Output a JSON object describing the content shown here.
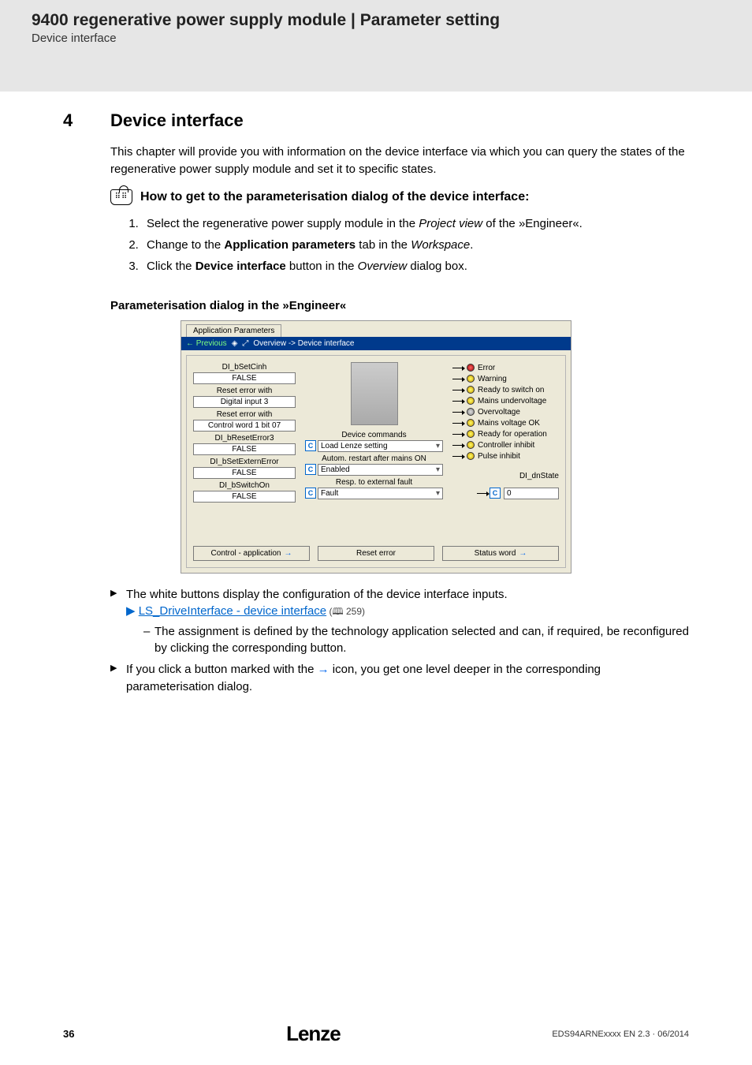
{
  "header": {
    "title": "9400 regenerative power supply module | Parameter setting",
    "subtitle": "Device interface"
  },
  "section": {
    "number": "4",
    "title": "Device interface"
  },
  "intro": "This chapter will provide you with information on the device interface via which you can query the states of the regenerative power supply module and set it to specific states.",
  "howto_title": "How to get to the parameterisation dialog of the device interface:",
  "steps": {
    "s1_a": "Select the regenerative power supply module in the ",
    "s1_b": "Project view",
    "s1_c": " of the »Engineer«.",
    "s2_a": "Change to the ",
    "s2_b": "Application parameters",
    "s2_c": " tab in the ",
    "s2_d": "Workspace",
    "s2_e": ".",
    "s3_a": "Click the ",
    "s3_b": "Device interface",
    "s3_c": " button in the ",
    "s3_d": "Overview",
    "s3_e": " dialog box."
  },
  "sub_heading": "Parameterisation dialog in the »Engineer«",
  "shot": {
    "tab": "Application Parameters",
    "nav_prev": "← Previous",
    "breadcrumb": "Overview -> Device interface",
    "left": [
      {
        "l": "DI_bSetCinh",
        "v": "FALSE"
      },
      {
        "l": "Reset error with",
        "v": "Digital input 3"
      },
      {
        "l": "Reset error with",
        "v": "Control word 1 bit 07"
      },
      {
        "l": "DI_bResetError3",
        "v": "FALSE"
      },
      {
        "l": "DI_bSetExternError",
        "v": "FALSE"
      },
      {
        "l": "DI_bSwitchOn",
        "v": "FALSE"
      }
    ],
    "mid": {
      "l1": "Device commands",
      "dd1": "Load Lenze setting",
      "l2": "Autom. restart after mains ON",
      "dd2": "Enabled",
      "l3": "Resp. to external fault",
      "dd3": "Fault"
    },
    "right": [
      {
        "t": "Error",
        "c": "red"
      },
      {
        "t": "Warning",
        "c": "yellow"
      },
      {
        "t": "Ready to switch on",
        "c": "yellow"
      },
      {
        "t": "Mains undervoltage",
        "c": "yellow"
      },
      {
        "t": "Overvoltage",
        "c": "gray"
      },
      {
        "t": "Mains voltage OK",
        "c": "yellow"
      },
      {
        "t": "Ready for operation",
        "c": "yellow"
      },
      {
        "t": "Controller inhibit",
        "c": "yellow"
      },
      {
        "t": "Pulse inhibit",
        "c": "yellow"
      }
    ],
    "state_label": "DI_dnState",
    "state_value": "0",
    "buttons": {
      "b1": "Control - application",
      "b2": "Reset error",
      "b3": "Status word"
    },
    "c": "C"
  },
  "notes": {
    "n1": "The white buttons display the configuration of the device interface inputs.",
    "link_prefix": "▶ ",
    "link": "LS_DriveInterface - device interface",
    "pageref": " (🕮 259)",
    "n1_sub": "The assignment is defined by the technology application selected and can, if required, be reconfigured by clicking the corresponding button.",
    "n2_a": "If you click a button marked with the ",
    "n2_arrow": "→",
    "n2_b": " icon, you get one level deeper in the corresponding parameterisation dialog."
  },
  "footer": {
    "page": "36",
    "brand": "Lenze",
    "docref": "EDS94ARNExxxx EN 2.3 · 06/2014"
  }
}
